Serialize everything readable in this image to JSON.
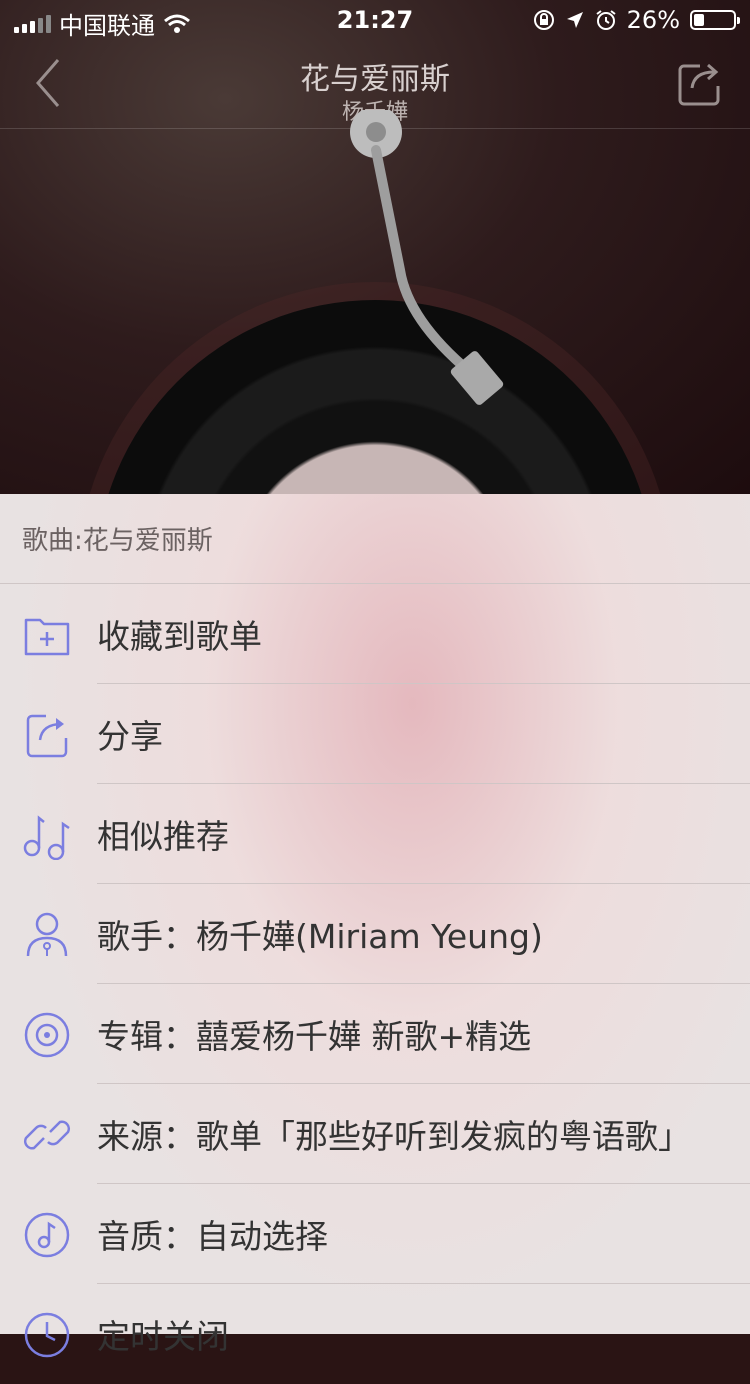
{
  "status_bar": {
    "carrier": "中国联通",
    "time": "21:27",
    "battery_percent": "26%",
    "battery_level": 0.26
  },
  "nav": {
    "title": "花与爱丽斯",
    "subtitle": "杨千嬅"
  },
  "sheet": {
    "header": "歌曲:花与爱丽斯",
    "items": [
      {
        "label": "收藏到歌单",
        "icon": "folder-add-icon"
      },
      {
        "label": "分享",
        "icon": "share-icon"
      },
      {
        "label": "相似推荐",
        "icon": "music-note-icon"
      },
      {
        "label": "歌手：杨千嬅(Miriam Yeung)",
        "icon": "artist-icon"
      },
      {
        "label": "专辑：囍爱杨千嬅 新歌+精选",
        "icon": "album-icon"
      },
      {
        "label": "来源：歌单「那些好听到发疯的粤语歌」",
        "icon": "link-icon"
      },
      {
        "label": "音质：自动选择",
        "icon": "quality-icon"
      },
      {
        "label": "定时关闭",
        "icon": "timer-icon"
      }
    ]
  },
  "colors": {
    "accent": "#7b7ee0",
    "text": "#333333",
    "secondary_text": "#6b6262"
  }
}
